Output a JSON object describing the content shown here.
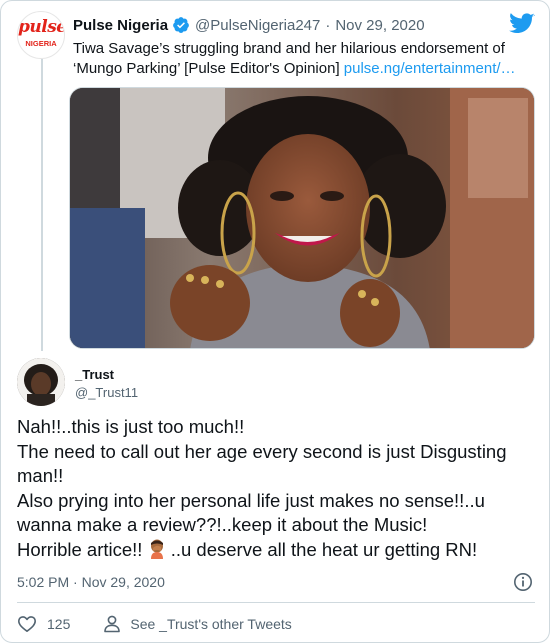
{
  "parent_tweet": {
    "avatar_logo_text": "pulse",
    "avatar_logo_sub": "NIGERIA",
    "display_name": "Pulse Nigeria",
    "handle": "@PulseNigeria247",
    "separator": "·",
    "date": "Nov 29, 2020",
    "text": "Tiwa Savage’s struggling brand and her hilarious endorsement of ‘Mungo Parking’ [Pulse Editor's Opinion]",
    "link": "pulse.ng/entertainment/…",
    "verified_icon": "verified-badge-icon",
    "brand_icon": "twitter-bird-icon"
  },
  "reply_tweet": {
    "display_name": "_Trust",
    "handle": "@_Trust11",
    "lines": [
      "Nah!!..this is just too much!!",
      "The need to call out her age every second is just Disgusting man!!",
      "Also prying into her personal life just makes no sense!!..u wanna make a review??!..keep it about the Music!",
      "Horrible artice!!",
      "..u deserve all the heat ur getting RN!"
    ],
    "emoji": "facepalm-emoji",
    "timestamp": "5:02 PM · Nov 29, 2020"
  },
  "actions": {
    "like_count": "125",
    "see_others_label": "See _Trust's other Tweets"
  },
  "colors": {
    "text": "#0f1419",
    "secondary": "#536471",
    "link": "#1d9bf0",
    "verified": "#1d9bf0",
    "pulse_red": "#e2231a",
    "border": "#cfd9de"
  }
}
